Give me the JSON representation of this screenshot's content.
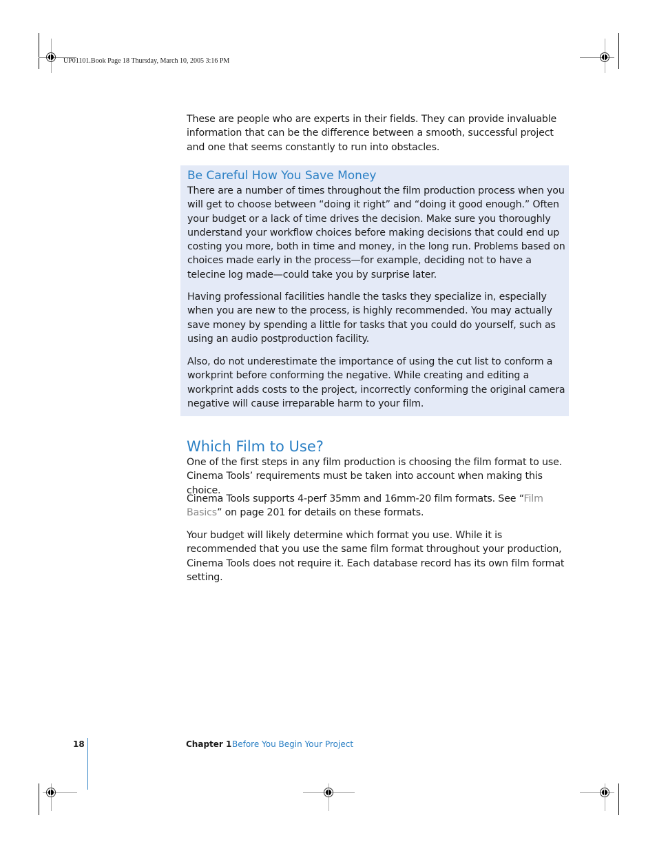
{
  "slug": "UP01101.Book  Page 18  Thursday, March 10, 2005  3:16 PM",
  "intro_paragraph": "These are people who are experts in their fields. They can provide invaluable information that can be the difference between a smooth, successful project and one that seems constantly to run into obstacles.",
  "sidebar": {
    "heading": "Be Careful How You Save Money",
    "paragraphs": [
      "There are a number of times throughout the film production process when you will get to choose between “doing it right” and “doing it good enough.” Often your budget or a lack of time drives the decision. Make sure you thoroughly understand your workflow choices before making decisions that could end up costing you more, both in time and money, in the long run. Problems based on choices made early in the process—for example, deciding not to have a telecine log made—could take you by surprise later.",
      "Having professional facilities handle the tasks they specialize in, especially when you are new to the process, is highly recommended. You may actually save money by spending a little for tasks that you could do yourself, such as using an audio postproduction facility.",
      "Also, do not underestimate the importance of using the cut list to conform a workprint before conforming the negative. While creating and editing a workprint adds costs to the project, incorrectly conforming the original camera negative will cause irreparable harm to your film."
    ]
  },
  "section": {
    "heading": "Which Film to Use?",
    "p1": "One of the first steps in any film production is choosing the film format to use. Cinema Tools’ requirements must be taken into account when making this choice.",
    "p2_before": "Cinema Tools supports 4-perf 35mm and 16mm-20 film formats. See “",
    "p2_link": "Film Basics",
    "p2_after": "” on page 201 for details on these formats.",
    "p3": "Your budget will likely determine which format you use. While it is recommended that you use the same film format throughout your production, Cinema Tools does not require it. Each database record has its own film format setting."
  },
  "footer": {
    "page_number": "18",
    "chapter_label": "Chapter 1",
    "chapter_title": "Before You Begin Your Project"
  }
}
